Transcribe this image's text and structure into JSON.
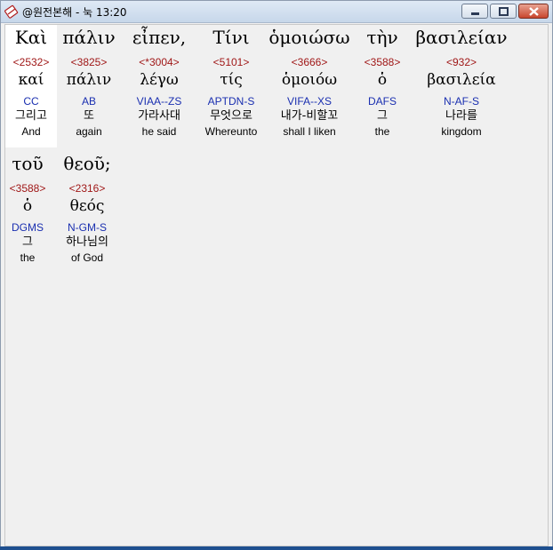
{
  "window": {
    "title": "@원전본해 - 눅 13:20"
  },
  "words": [
    {
      "greek": "Καὶ",
      "strong": "<2532>",
      "lemma": "καί",
      "parse": "CC",
      "korean": "그리고",
      "english": "And"
    },
    {
      "greek": "πάλιν",
      "strong": "<3825>",
      "lemma": "πάλιν",
      "parse": "AB",
      "korean": "또",
      "english": "again"
    },
    {
      "greek": "εἶπεν,",
      "strong": "<*3004>",
      "lemma": "λέγω",
      "parse": "VIAA--ZS",
      "korean": "가라사대",
      "english": "he said"
    },
    {
      "greek": "Τίνι",
      "strong": "<5101>",
      "lemma": "τίς",
      "parse": "APTDN-S",
      "korean": "무엇으로",
      "english": "Whereunto"
    },
    {
      "greek": "ὁμοιώσω",
      "strong": "<3666>",
      "lemma": "ὁμοιόω",
      "parse": "VIFA--XS",
      "korean": "내가-비할꼬",
      "english": "shall I liken"
    },
    {
      "greek": "τὴν",
      "strong": "<3588>",
      "lemma": "ὁ",
      "parse": "DAFS",
      "korean": "그",
      "english": "the"
    },
    {
      "greek": "βασιλείαν",
      "strong": "<932>",
      "lemma": "βασιλεία",
      "parse": "N-AF-S",
      "korean": "나라를",
      "english": "kingdom"
    },
    {
      "greek": "τοῦ",
      "strong": "<3588>",
      "lemma": "ὁ",
      "parse": "DGMS",
      "korean": "그",
      "english": "the"
    },
    {
      "greek": "θεοῦ;",
      "strong": "<2316>",
      "lemma": "θεός",
      "parse": "N-GM-S",
      "korean": "하나님의",
      "english": "of God"
    }
  ]
}
